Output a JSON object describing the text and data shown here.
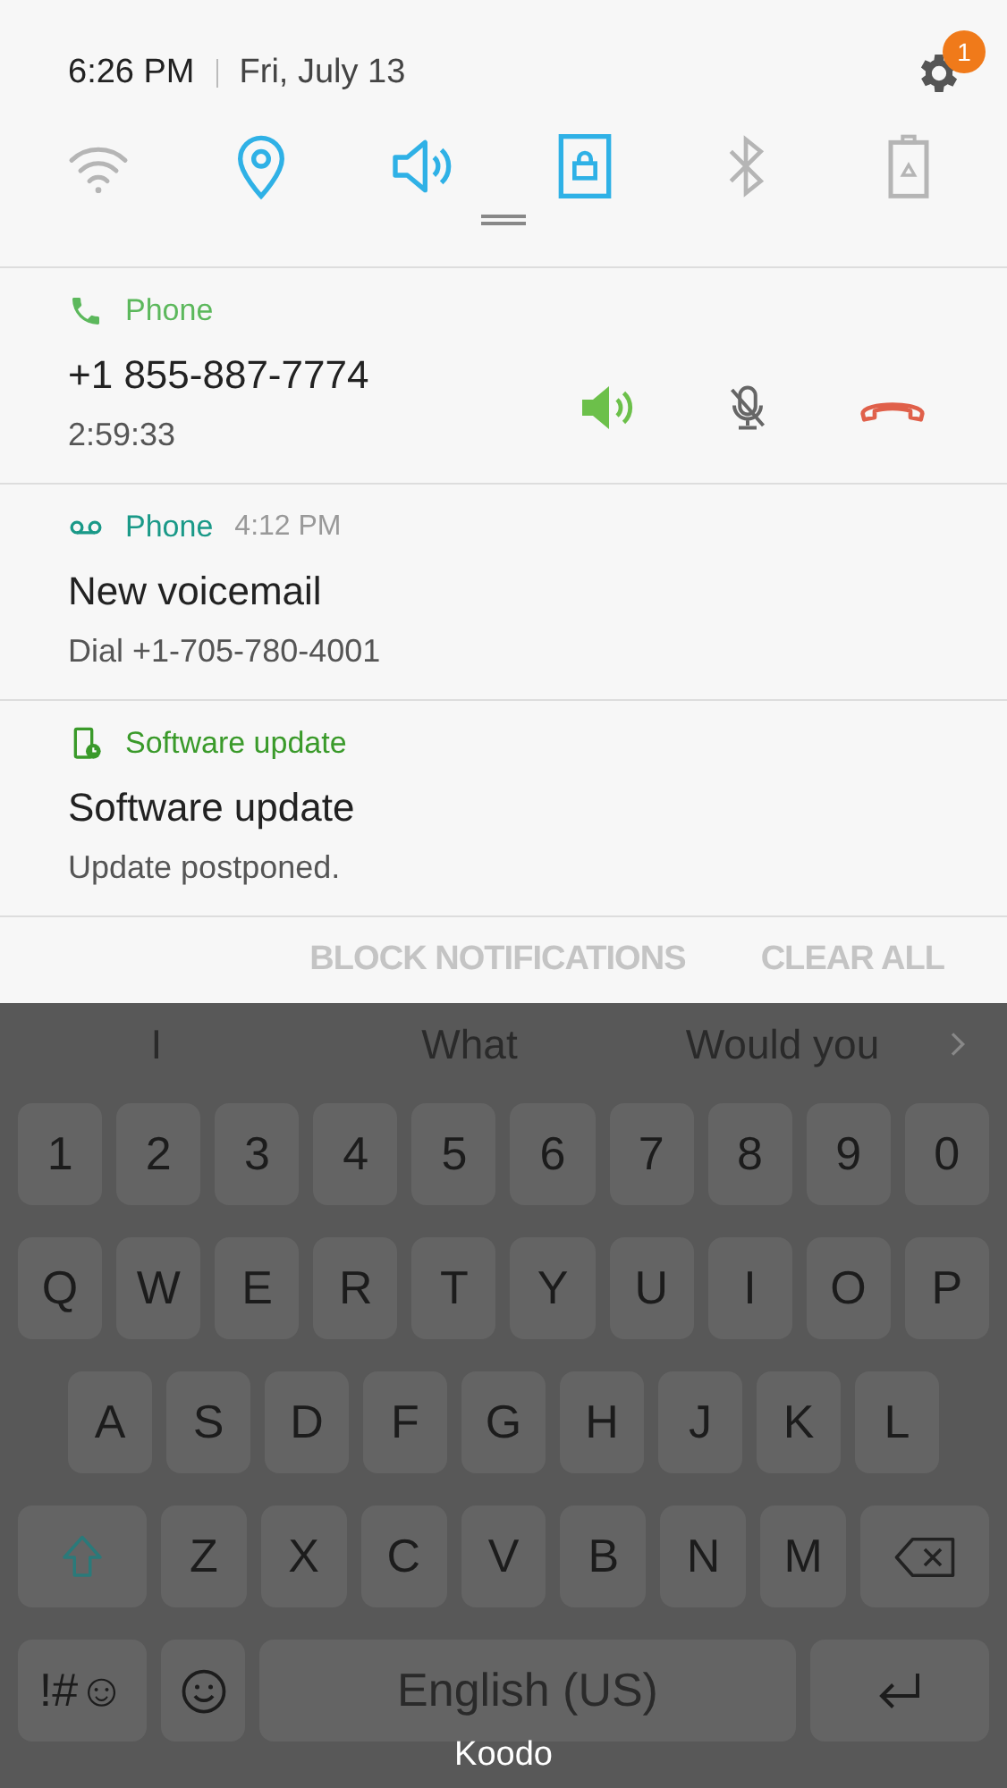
{
  "status": {
    "time": "6:26 PM",
    "date": "Fri, July 13",
    "settings_badge": "1"
  },
  "quick_toggles": [
    {
      "kind": "wifi",
      "on": false
    },
    {
      "kind": "location",
      "on": true
    },
    {
      "kind": "sound",
      "on": true
    },
    {
      "kind": "rotation-lock",
      "on": true
    },
    {
      "kind": "bluetooth",
      "on": false
    },
    {
      "kind": "power-saving",
      "on": false
    }
  ],
  "notifications": [
    {
      "kind": "call",
      "app": "Phone",
      "title": "+1 855-887-7774",
      "text": "2:59:33"
    },
    {
      "kind": "voicemail",
      "app": "Phone",
      "time": "4:12 PM",
      "title": "New voicemail",
      "text": "Dial +1-705-780-4001"
    },
    {
      "kind": "update",
      "app": "Software update",
      "title": "Software update",
      "text": "Update postponed."
    }
  ],
  "actions": [
    "BLOCK NOTIFICATIONS",
    "CLEAR ALL"
  ],
  "keyboard": {
    "suggestions": [
      "I",
      "What",
      "Would you"
    ],
    "rows": [
      [
        "1",
        "2",
        "3",
        "4",
        "5",
        "6",
        "7",
        "8",
        "9",
        "0"
      ],
      [
        "Q",
        "W",
        "E",
        "R",
        "T",
        "Y",
        "U",
        "I",
        "O",
        "P"
      ],
      [
        "A",
        "S",
        "D",
        "F",
        "G",
        "H",
        "J",
        "K",
        "L"
      ],
      [
        "Z",
        "X",
        "C",
        "V",
        "B",
        "N",
        "M"
      ]
    ],
    "symbols_key": "!#☺",
    "space_label": "English (US)"
  },
  "carrier": "Koodo"
}
